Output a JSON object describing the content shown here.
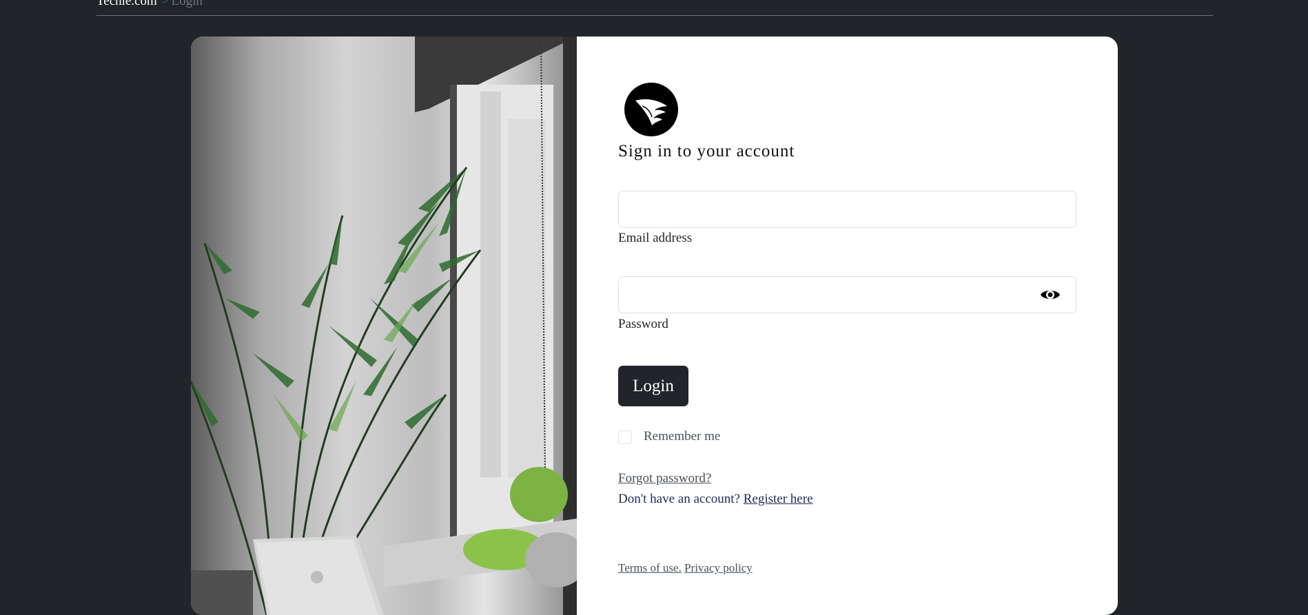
{
  "breadcrumb": {
    "home": "Techie.com",
    "separator": ">",
    "current": "Login"
  },
  "photo": {
    "alt": "Office window with palm plant and laptop"
  },
  "logo": {
    "icon": "wing-icon"
  },
  "form": {
    "heading": "Sign in to your account",
    "email_label": "Email address",
    "email_value": "",
    "password_label": "Password",
    "password_value": "",
    "toggle_icon": "eye-icon",
    "login_label": "Login",
    "remember_label": "Remember me",
    "remember_checked": false,
    "forgot_label": "Forgot password?",
    "register_prompt": "Don't have an account?",
    "register_label": "Register here"
  },
  "footer": {
    "terms_label": "Terms of use.",
    "privacy_label": "Privacy policy"
  },
  "colors": {
    "page_bg": "#212529",
    "card_bg": "#ffffff",
    "button_bg": "#212529",
    "breadcrumb_sep": "#198754"
  }
}
